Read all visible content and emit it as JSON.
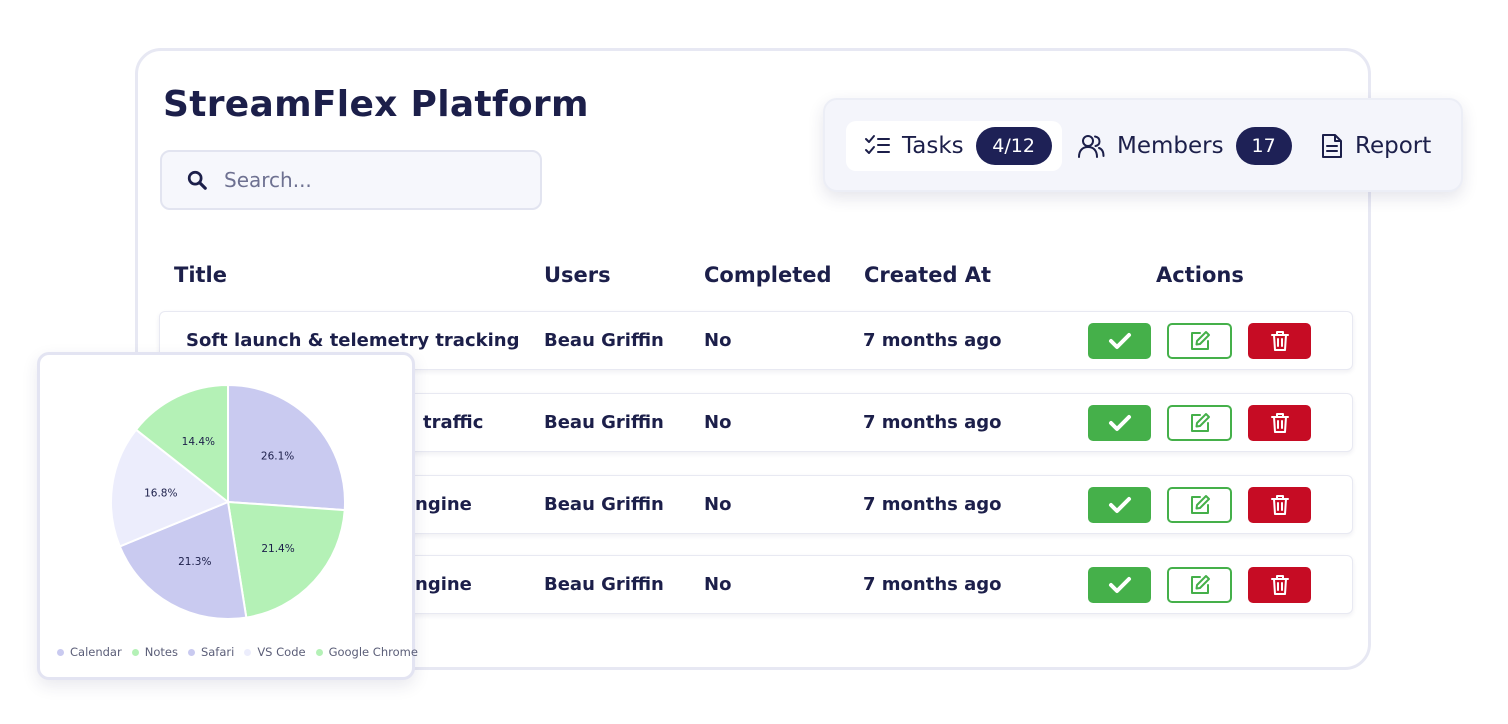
{
  "app": {
    "title": "StreamFlex Platform"
  },
  "search": {
    "placeholder": "Search..."
  },
  "tabs": [
    {
      "label": "Tasks",
      "badge": "4/12",
      "icon": "checklist-icon"
    },
    {
      "label": "Members",
      "badge": "17",
      "icon": "users-icon"
    },
    {
      "label": "Report",
      "icon": "document-icon"
    }
  ],
  "table": {
    "headers": {
      "title": "Title",
      "users": "Users",
      "completed": "Completed",
      "created": "Created At",
      "actions": "Actions"
    },
    "rows": [
      {
        "title": "Soft launch & telemetry tracking",
        "users": "Beau Griffin",
        "completed": "No",
        "created": "7 months ago"
      },
      {
        "title": "traffic",
        "users": "Beau Griffin",
        "completed": "No",
        "created": "7 months ago"
      },
      {
        "title": "ngine",
        "users": "Beau Griffin",
        "completed": "No",
        "created": "7 months ago"
      },
      {
        "title": "ngine",
        "users": "Beau Griffin",
        "completed": "No",
        "created": "7 months ago"
      }
    ]
  },
  "colors": {
    "complete": "#45b04a",
    "delete": "#c60c24",
    "badge": "#1e2156",
    "pie": {
      "Calendar": "#c9caf0",
      "Notes": "#b4f1b6",
      "Safari": "#c9caf0",
      "VS Code": "#ecedfc",
      "Google Chrome": "#b4f1b6"
    }
  },
  "chart_data": {
    "type": "pie",
    "slices": [
      {
        "name": "Calendar",
        "value": 26.1,
        "label": "26.1%"
      },
      {
        "name": "Notes",
        "value": 21.4,
        "label": "21.4%"
      },
      {
        "name": "Safari",
        "value": 21.3,
        "label": "21.3%"
      },
      {
        "name": "VS Code",
        "value": 16.8,
        "label": "16.8%"
      },
      {
        "name": "Google Chrome",
        "value": 14.4,
        "label": "14.4%"
      }
    ],
    "legend": [
      "Calendar",
      "Notes",
      "Safari",
      "VS Code",
      "Google Chrome"
    ],
    "legend_position": "bottom"
  }
}
